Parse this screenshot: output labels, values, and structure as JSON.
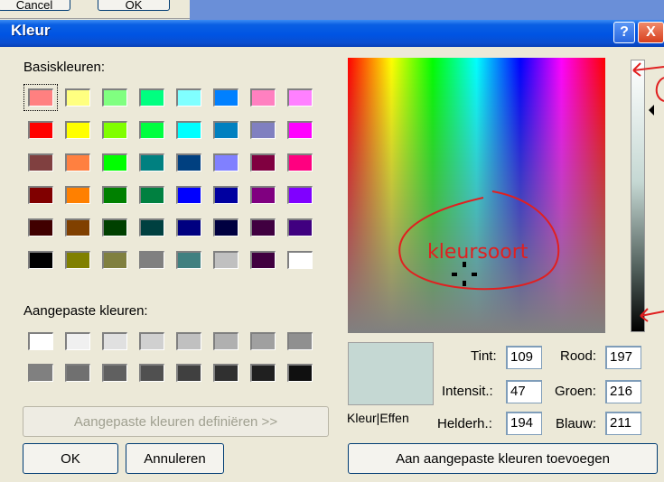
{
  "back_dialog": {
    "cancel_label": "Cancel",
    "ok_label": "OK"
  },
  "window": {
    "title": "Kleur",
    "help_label": "?",
    "close_label": "X"
  },
  "basic_colors": {
    "label": "Basiskleuren:",
    "rows": [
      [
        "#FF8080",
        "#FFFF80",
        "#80FF80",
        "#00FF80",
        "#80FFFF",
        "#0080FF",
        "#FF80C0",
        "#FF80FF"
      ],
      [
        "#FF0000",
        "#FFFF00",
        "#80FF00",
        "#00FF40",
        "#00FFFF",
        "#0080C0",
        "#8080C0",
        "#FF00FF"
      ],
      [
        "#804040",
        "#FF8040",
        "#00FF00",
        "#008080",
        "#004080",
        "#8080FF",
        "#800040",
        "#FF0080"
      ],
      [
        "#800000",
        "#FF8000",
        "#008000",
        "#008040",
        "#0000FF",
        "#0000A0",
        "#800080",
        "#8000FF"
      ],
      [
        "#400000",
        "#804000",
        "#004000",
        "#004040",
        "#000080",
        "#000040",
        "#400040",
        "#400080"
      ],
      [
        "#000000",
        "#808000",
        "#808040",
        "#808080",
        "#408080",
        "#C0C0C0",
        "#400040",
        "#FFFFFF"
      ]
    ]
  },
  "custom_colors": {
    "label": "Aangepaste kleuren:",
    "rows": [
      [
        "#FFFFFF",
        "#F0F0F0",
        "#E0E0E0",
        "#D0D0D0",
        "#C0C0C0",
        "#B0B0B0",
        "#A0A0A0",
        "#909090"
      ],
      [
        "#808080",
        "#707070",
        "#606060",
        "#505050",
        "#404040",
        "#303030",
        "#202020",
        "#101010"
      ]
    ]
  },
  "define_custom_label": "Aangepaste kleuren definiëren >>",
  "ok_label": "OK",
  "cancel_label": "Annuleren",
  "annotation_text": "kleursoort",
  "preview": {
    "label": "Kleur|Effen",
    "color": "#C5D8D3"
  },
  "fields": {
    "tint": {
      "label": "Tint:",
      "value": "109"
    },
    "intensity": {
      "label": "Intensit.:",
      "value": "47"
    },
    "brightness": {
      "label": "Helderh.:",
      "value": "194"
    },
    "red": {
      "label": "Rood:",
      "value": "197"
    },
    "green": {
      "label": "Groen:",
      "value": "216"
    },
    "blue": {
      "label": "Blauw:",
      "value": "211"
    }
  },
  "add_custom_label": "Aan aangepaste kleuren toevoegen",
  "colors": {
    "title_bar": "#0054E3",
    "annotation": "#E02020",
    "dialog_bg": "#ECE9D8"
  }
}
